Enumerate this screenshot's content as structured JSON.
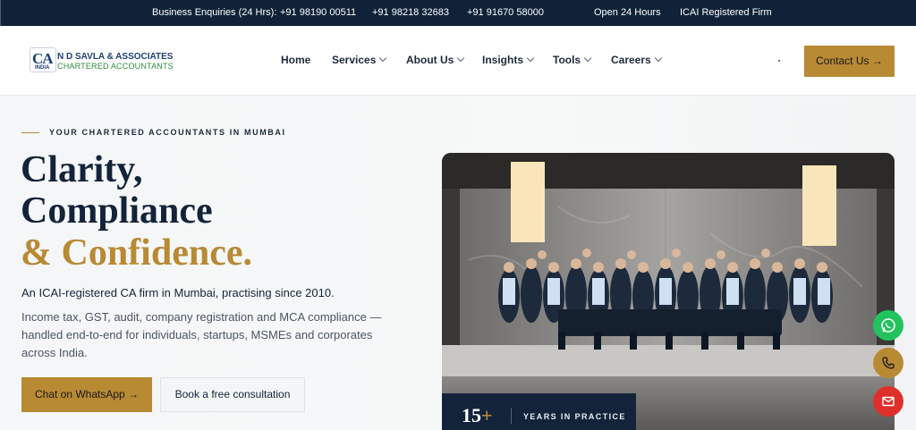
{
  "topbar": {
    "enquiries_label": "Business Enquiries (24 Hrs):",
    "phones": [
      "+91 98190 00511",
      "+91 98218 32683",
      "+91 91670 58000"
    ],
    "hours": "Open 24 Hours",
    "registration": "ICAI Registered Firm"
  },
  "brand": {
    "logo_letters": "CA",
    "logo_country": "INDIA",
    "name": "N D SAVLA & ASSOCIATES",
    "tagline": "CHARTERED ACCOUNTANTS"
  },
  "nav": {
    "items": [
      {
        "label": "Home",
        "dropdown": false
      },
      {
        "label": "Services",
        "dropdown": true
      },
      {
        "label": "About Us",
        "dropdown": true
      },
      {
        "label": "Insights",
        "dropdown": true
      },
      {
        "label": "Tools",
        "dropdown": true
      },
      {
        "label": "Careers",
        "dropdown": true
      }
    ],
    "contact_label": "Contact Us →"
  },
  "hero": {
    "eyebrow": "YOUR CHARTERED ACCOUNTANTS IN MUMBAI",
    "headline_line1": "Clarity,",
    "headline_line2": "Compliance",
    "headline_line3": "& Confidence.",
    "lead": "An ICAI-registered CA firm in Mumbai, practising since 2010.",
    "description": "Income tax, GST, audit, company registration and MCA compliance — handled end-to-end for individuals, startups, MSMEs and corporates across India.",
    "cta_primary": "Chat on WhatsApp →",
    "cta_secondary": "Book a free consultation"
  },
  "stat": {
    "number": "15",
    "suffix": "+",
    "label": "YEARS IN PRACTICE"
  },
  "colors": {
    "navy": "#0f2238",
    "gold": "#b88a34",
    "whatsapp": "#22c35e",
    "mail": "#df2f2a"
  },
  "floating": {
    "icons": [
      "whatsapp-icon",
      "phone-icon",
      "mail-icon"
    ]
  }
}
